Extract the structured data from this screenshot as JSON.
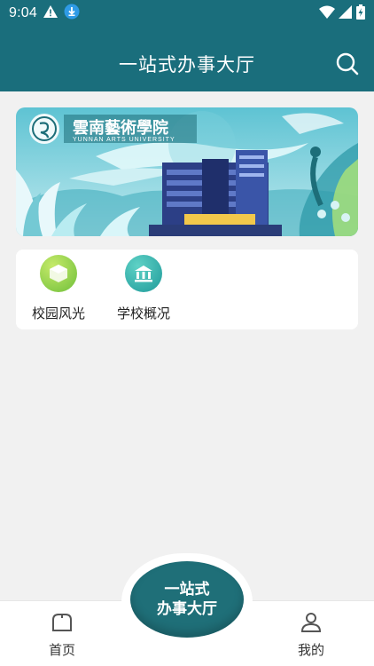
{
  "status_bar": {
    "time": "9:04",
    "icons": [
      "warning-icon",
      "download-icon",
      "wifi-icon",
      "signal-icon",
      "battery-charging-icon"
    ]
  },
  "header": {
    "title": "一站式办事大厅",
    "search_icon": "search-icon"
  },
  "banner": {
    "school_name_cn": "雲南藝術學院",
    "school_name_en": "YUNNAN ARTS UNIVERSITY"
  },
  "shortcuts": [
    {
      "label": "校园风光",
      "icon": "campus-scenery-icon",
      "color": "#8cc63f"
    },
    {
      "label": "学校概况",
      "icon": "school-building-icon",
      "color": "#2bb0a8"
    }
  ],
  "tabbar": {
    "home_label": "首页",
    "center_line1": "一站式",
    "center_line2": "办事大厅",
    "mine_label": "我的"
  },
  "colors": {
    "primary": "#1a6e7c",
    "background": "#f1f1f1"
  }
}
